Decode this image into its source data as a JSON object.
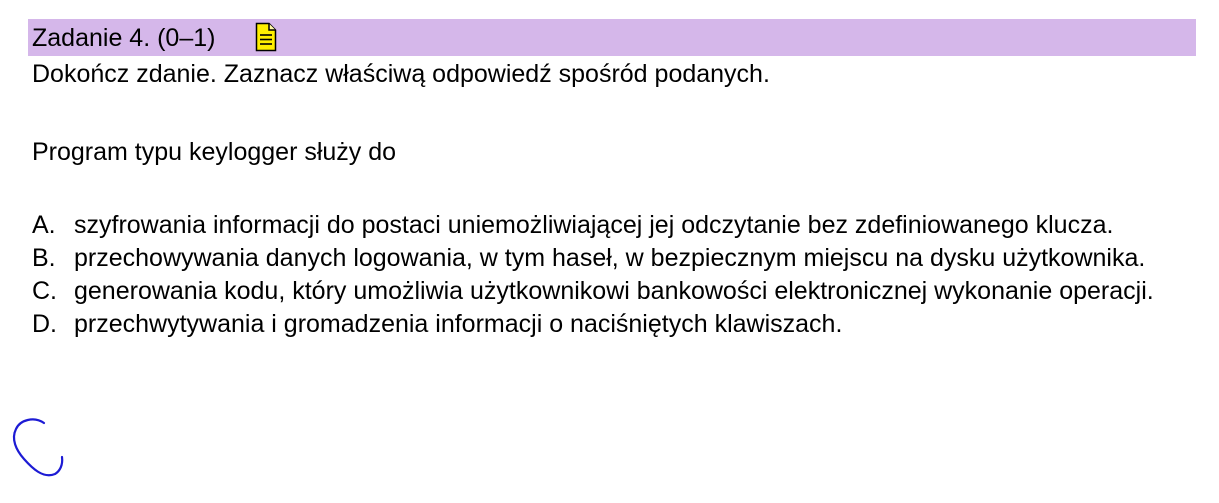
{
  "header": {
    "title": "Zadanie 4. (0–1)",
    "background_color": "#d5b7ea",
    "icon": "note-icon"
  },
  "instruction": "Dokończ zdanie. Zaznacz właściwą odpowiedź spośród podanych.",
  "stem": "Program typu keylogger służy do",
  "options": [
    {
      "letter": "A.",
      "text": "szyfrowania informacji do postaci uniemożliwiającej jej odczytanie bez zdefiniowanego klucza."
    },
    {
      "letter": "B.",
      "text": "przechowywania danych logowania, w tym haseł, w bezpiecznym miejscu na dysku użytkownika."
    },
    {
      "letter": "C.",
      "text": "generowania kodu, który umożliwia użytkownikowi bankowości elektronicznej wykonanie operacji."
    },
    {
      "letter": "D.",
      "text": "przechwytywania i gromadzenia informacji o naciśniętych klawiszach."
    }
  ],
  "selected_answer": "D",
  "mark_color": "#1d1bd4"
}
